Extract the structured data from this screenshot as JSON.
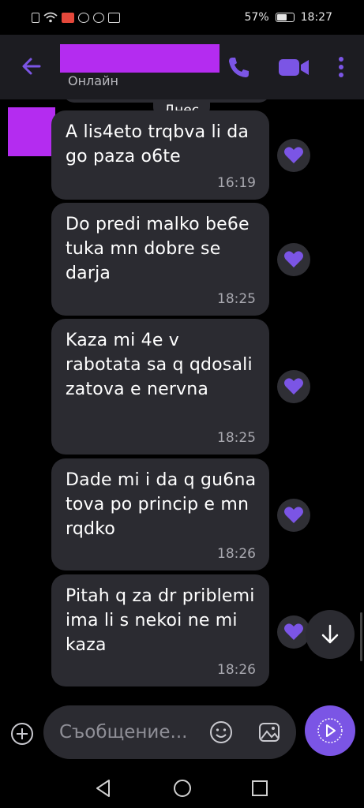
{
  "status_bar": {
    "battery_percent": "57%",
    "time": "18:27",
    "icons": [
      "sim-alert-icon",
      "wifi-icon",
      "notification-red-icon",
      "viber-icon",
      "viber-icon",
      "mail-icon"
    ]
  },
  "header": {
    "contact_status": "Онлайн",
    "icons": [
      "back-arrow-icon",
      "phone-icon",
      "video-camera-icon",
      "more-vertical-icon"
    ],
    "accent_color": "#7b55e5"
  },
  "chat": {
    "date_separator": "Днес",
    "messages": [
      {
        "text": "A lis4eto trqbva li da go paza o6te",
        "time": "16:19"
      },
      {
        "text": "Do predi malko be6e tuka mn dobre se darja",
        "time": "18:25"
      },
      {
        "text": "Kaza mi 4e v rabotata sa q qdosali zatova e nervna",
        "time": "18:25"
      },
      {
        "text": "Dade mi i da q gu6na tova po princip e mn rqdko",
        "time": "18:26"
      },
      {
        "text": "Pitah q za dr priblemi ima li s nekoi ne mi kaza",
        "time": "18:26"
      }
    ],
    "reaction_icon": "heart-icon",
    "reaction_color": "#7b55e5",
    "bubble_color": "#2b2b31"
  },
  "compose": {
    "placeholder": "Съобщение...",
    "icons": [
      "plus-icon",
      "emoji-icon",
      "sticker-icon",
      "send-icon"
    ]
  },
  "nav_bar": {
    "icons": [
      "nav-back-icon",
      "nav-home-icon",
      "nav-recents-icon"
    ]
  }
}
